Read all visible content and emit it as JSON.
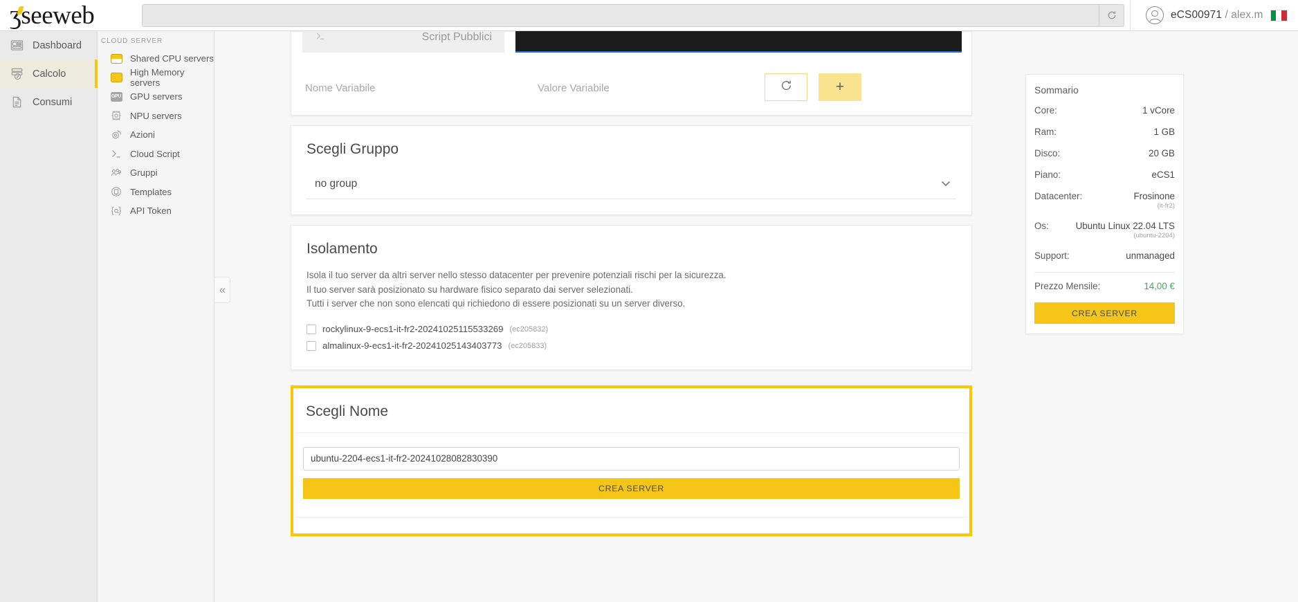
{
  "header": {
    "logo_text": "seeweb",
    "search_placeholder": "",
    "search_value": "",
    "refresh_icon": "refresh-icon",
    "account": "eCS00971",
    "account_separator": " / ",
    "account_user": "alex.m",
    "language_flag": "it"
  },
  "rail": {
    "items": [
      {
        "label": "Dashboard",
        "icon": "dashboard-icon",
        "active": false
      },
      {
        "label": "Calcolo",
        "icon": "server-check-icon",
        "active": true
      },
      {
        "label": "Consumi",
        "icon": "document-icon",
        "active": false
      }
    ]
  },
  "subnav": {
    "title": "CLOUD SERVER",
    "items": [
      {
        "label": "Shared CPU servers",
        "icon": "cpu-chip-split-icon"
      },
      {
        "label": "High Memory servers",
        "icon": "cpu-chip-icon"
      },
      {
        "label": "GPU servers",
        "icon": "gpu-chip-icon"
      },
      {
        "label": "NPU servers",
        "icon": "npu-chip-icon"
      },
      {
        "label": "Azioni",
        "icon": "gear-refresh-icon"
      },
      {
        "label": "Cloud Script",
        "icon": "terminal-icon"
      },
      {
        "label": "Gruppi",
        "icon": "users-group-icon"
      },
      {
        "label": "Templates",
        "icon": "template-icon"
      },
      {
        "label": "API Token",
        "icon": "api-token-icon"
      }
    ]
  },
  "collapse": {
    "icon": "chevron-double-left-icon"
  },
  "script_block": {
    "tab_label": "Script Pubblici",
    "tab_icon": "terminal-icon",
    "variable_name_placeholder": "Nome Variabile",
    "variable_value_placeholder": "Valore Variabile",
    "refresh_icon": "refresh-icon",
    "add_icon": "plus-icon"
  },
  "group_section": {
    "title": "Scegli Gruppo",
    "selected": "no group",
    "chevron_icon": "chevron-down-icon"
  },
  "isolation_section": {
    "title": "Isolamento",
    "line1": "Isola il tuo server da altri server nello stesso datacenter per prevenire potenziali rischi per la sicurezza.",
    "line2": "Il tuo server sarà posizionato su hardware fisico separato dai server selezionati.",
    "line3": "Tutti i server che non sono elencati qui richiedono di essere posizionati su un server diverso.",
    "servers": [
      {
        "name": "rockylinux-9-ecs1-it-fr2-20241025115533269",
        "id": "(ec205832)",
        "checked": false
      },
      {
        "name": "almalinux-9-ecs1-it-fr2-20241025143403773",
        "id": "(ec205833)",
        "checked": false
      }
    ]
  },
  "name_section": {
    "title": "Scegli Nome",
    "input_value": "ubuntu-2204-ecs1-it-fr2-20241028082830390",
    "input_placeholder": "",
    "create_button": "CREA SERVER"
  },
  "summary": {
    "title": "Sommario",
    "rows": [
      {
        "label": "Core:",
        "value": "1 vCore",
        "sub": ""
      },
      {
        "label": "Ram:",
        "value": "1 GB",
        "sub": ""
      },
      {
        "label": "Disco:",
        "value": "20 GB",
        "sub": ""
      },
      {
        "label": "Piano:",
        "value": "eCS1",
        "sub": ""
      },
      {
        "label": "Datacenter:",
        "value": "Frosinone",
        "sub": "(it-fr2)"
      },
      {
        "label": "Os:",
        "value": "Ubuntu Linux 22.04 LTS",
        "sub": "(ubuntu-2204)"
      },
      {
        "label": "Support:",
        "value": "unmanaged",
        "sub": ""
      }
    ],
    "price_label": "Prezzo Mensile:",
    "price_value": "14,00 €",
    "create_button": "CREA SERVER"
  },
  "colors": {
    "accent_yellow": "#f5c518",
    "highlight_border": "#fbc800",
    "price_green": "#3fae5a",
    "editor_black": "#1c1c1c",
    "editor_underline": "#1976c8"
  }
}
